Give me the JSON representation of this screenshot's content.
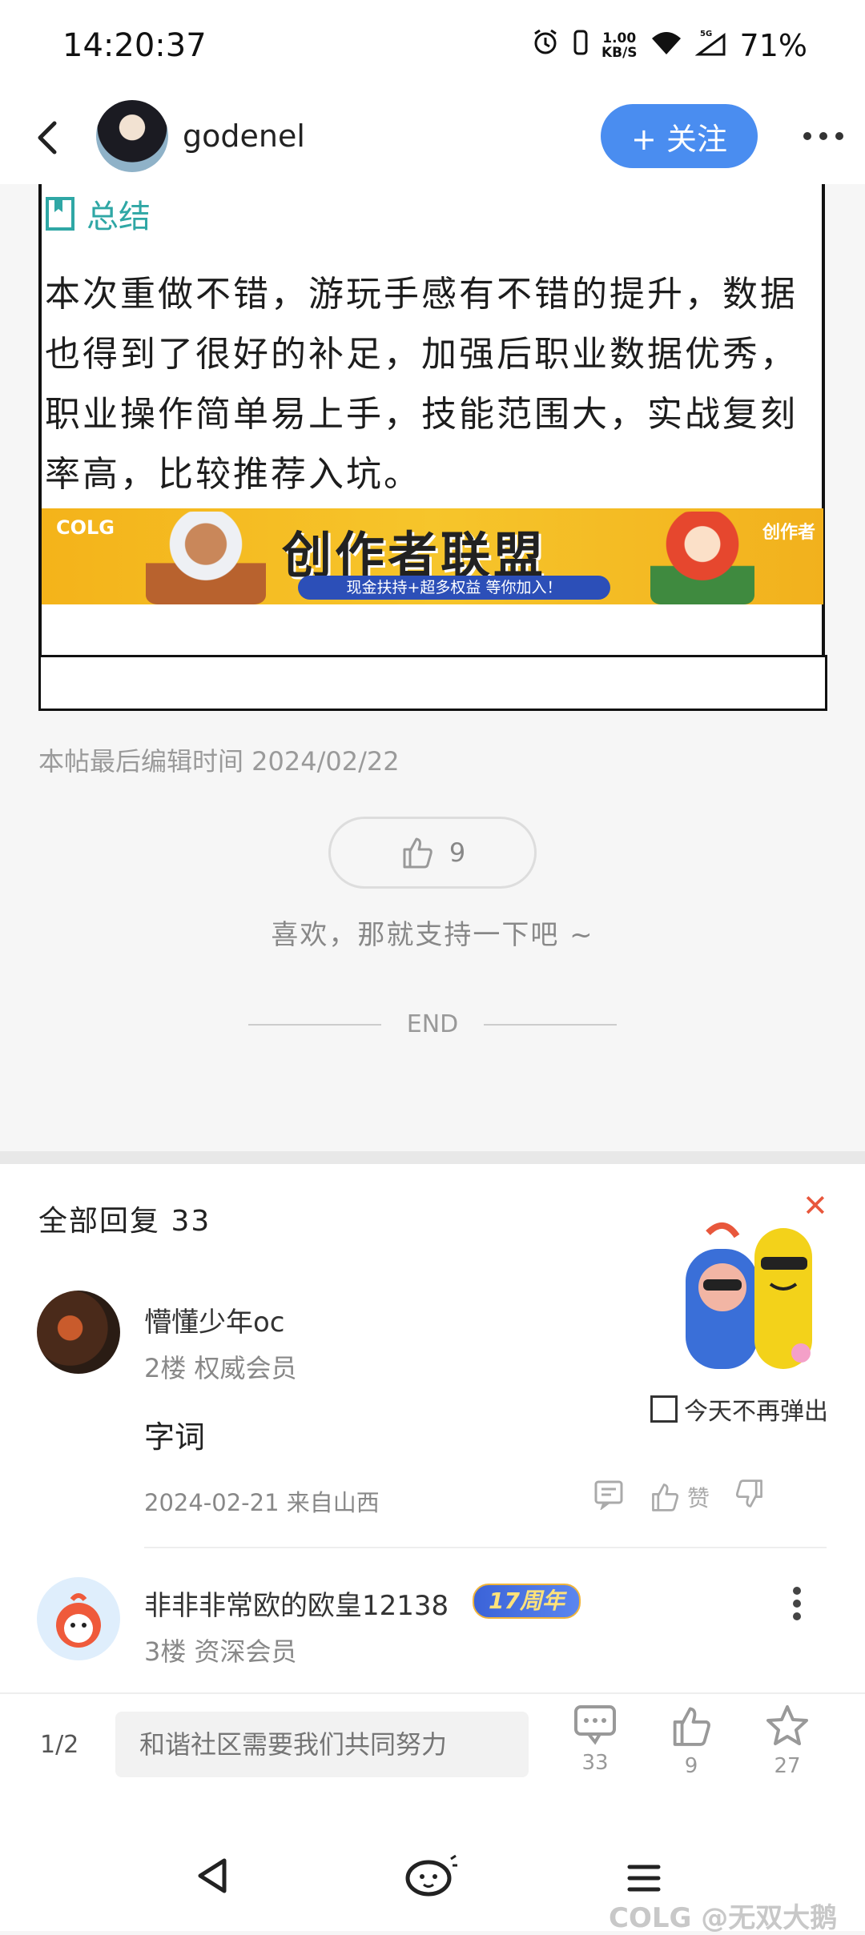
{
  "status_bar": {
    "time": "14:20:37",
    "net_speed_value": "1.00",
    "net_speed_unit": "KB/S",
    "network": "5G",
    "battery": "71%"
  },
  "header": {
    "username": "godenel",
    "follow_label": "+ 关注"
  },
  "article": {
    "section_title": "总结",
    "body": "本次重做不错，游玩手感有不错的提升，数据也得到了很好的补足，加强后职业数据优秀，职业操作简单易上手，技能范围大，实战复刻率高，比较推荐入坑。",
    "banner": {
      "logo": "COLG",
      "title": "创作者联盟",
      "subtitle": "现金扶持+超多权益 等你加入！",
      "right_logo": "创作者"
    },
    "edit_time": "本帖最后编辑时间 2024/02/22",
    "like_count": "9",
    "like_hint": "喜欢，那就支持一下吧 ~",
    "end_label": "END"
  },
  "replies": {
    "header": "全部回复 33",
    "items": [
      {
        "name": "懵懂少年oc",
        "meta": "2楼 权威会员",
        "content": "字词",
        "date": "2024-02-21 来自山西",
        "like_label": "赞"
      },
      {
        "name": "非非非常欧的欧皇12138",
        "badge": "17周年",
        "meta": "3楼 资深会员"
      }
    ]
  },
  "popup": {
    "checkbox_label": "今天不再弹出"
  },
  "bottom_bar": {
    "page": "1/2",
    "input_placeholder": "和谐社区需要我们共同努力",
    "comments_count": "33",
    "likes_count": "9",
    "favorites_count": "27"
  },
  "watermark": "COLG @无双大鹅"
}
